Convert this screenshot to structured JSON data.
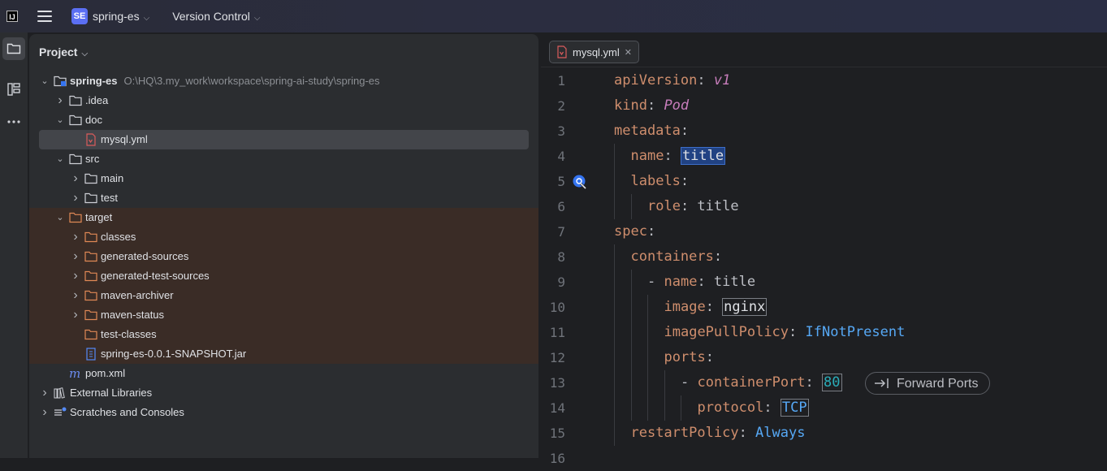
{
  "titlebar": {
    "app_logo": "IJ",
    "project_badge": "SE",
    "project_name": "spring-es",
    "vcs_label": "Version Control"
  },
  "panel": {
    "title": "Project"
  },
  "tree": [
    {
      "label": "spring-es",
      "hint": "O:\\HQ\\3.my_work\\workspace\\spring-ai-study\\spring-es",
      "icon": "module-folder-icon",
      "arrow": "down",
      "depth": 0
    },
    {
      "label": ".idea",
      "icon": "folder-icon",
      "arrow": "right",
      "depth": 1
    },
    {
      "label": "doc",
      "icon": "folder-icon",
      "arrow": "down",
      "depth": 1
    },
    {
      "label": "mysql.yml",
      "icon": "yaml-file-icon",
      "arrow": "",
      "depth": 2,
      "selected": true
    },
    {
      "label": "src",
      "icon": "folder-icon",
      "arrow": "down",
      "depth": 1
    },
    {
      "label": "main",
      "icon": "folder-icon",
      "arrow": "right",
      "depth": 2
    },
    {
      "label": "test",
      "icon": "folder-icon",
      "arrow": "right",
      "depth": 2
    },
    {
      "label": "target",
      "icon": "excluded-folder-icon",
      "arrow": "down",
      "depth": 1,
      "excluded": true
    },
    {
      "label": "classes",
      "icon": "excluded-folder-icon",
      "arrow": "right",
      "depth": 2,
      "excluded": true
    },
    {
      "label": "generated-sources",
      "icon": "excluded-folder-icon",
      "arrow": "right",
      "depth": 2,
      "excluded": true
    },
    {
      "label": "generated-test-sources",
      "icon": "excluded-folder-icon",
      "arrow": "right",
      "depth": 2,
      "excluded": true
    },
    {
      "label": "maven-archiver",
      "icon": "excluded-folder-icon",
      "arrow": "right",
      "depth": 2,
      "excluded": true
    },
    {
      "label": "maven-status",
      "icon": "excluded-folder-icon",
      "arrow": "right",
      "depth": 2,
      "excluded": true
    },
    {
      "label": "test-classes",
      "icon": "excluded-folder-icon",
      "arrow": "",
      "depth": 2,
      "excluded": true
    },
    {
      "label": "spring-es-0.0.1-SNAPSHOT.jar",
      "icon": "jar-file-icon",
      "arrow": "",
      "depth": 2,
      "excluded": true
    },
    {
      "label": "pom.xml",
      "icon": "maven-icon",
      "arrow": "",
      "depth": 1
    },
    {
      "label": "External Libraries",
      "icon": "libraries-icon",
      "arrow": "right",
      "depth": 0
    },
    {
      "label": "Scratches and Consoles",
      "icon": "scratches-icon",
      "arrow": "right",
      "depth": 0
    }
  ],
  "editor": {
    "tab_label": "mysql.yml",
    "forward_ports": "Forward Ports",
    "lines": [
      {
        "n": "1",
        "indent": 0,
        "segs": [
          [
            "key",
            "apiVersion"
          ],
          [
            "plain",
            ": "
          ],
          [
            "val-kw",
            "v1"
          ]
        ]
      },
      {
        "n": "2",
        "indent": 0,
        "segs": [
          [
            "key",
            "kind"
          ],
          [
            "plain",
            ": "
          ],
          [
            "val-kw",
            "Pod"
          ]
        ]
      },
      {
        "n": "3",
        "indent": 0,
        "segs": [
          [
            "key",
            "metadata"
          ],
          [
            "plain",
            ":"
          ]
        ]
      },
      {
        "n": "4",
        "indent": 1,
        "segs": [
          [
            "key",
            "name"
          ],
          [
            "plain",
            ": "
          ],
          [
            "hl-sel",
            "title"
          ]
        ]
      },
      {
        "n": "5",
        "indent": 1,
        "segs": [
          [
            "key",
            "labels"
          ],
          [
            "plain",
            ":"
          ]
        ]
      },
      {
        "n": "6",
        "indent": 2,
        "segs": [
          [
            "key",
            "role"
          ],
          [
            "plain",
            ": title"
          ]
        ]
      },
      {
        "n": "7",
        "indent": 0,
        "segs": [
          [
            "key",
            "spec"
          ],
          [
            "plain",
            ":"
          ]
        ]
      },
      {
        "n": "8",
        "indent": 1,
        "segs": [
          [
            "key",
            "containers"
          ],
          [
            "plain",
            ":"
          ]
        ]
      },
      {
        "n": "9",
        "indent": 2,
        "segs": [
          [
            "plain",
            "- "
          ],
          [
            "key",
            "name"
          ],
          [
            "plain",
            ": title"
          ]
        ]
      },
      {
        "n": "10",
        "indent": 3,
        "segs": [
          [
            "key",
            "image"
          ],
          [
            "plain",
            ": "
          ],
          [
            "boxed",
            "nginx"
          ]
        ]
      },
      {
        "n": "11",
        "indent": 3,
        "segs": [
          [
            "key",
            "imagePullPolicy"
          ],
          [
            "plain",
            ": "
          ],
          [
            "val-blue",
            "IfNotPresent"
          ]
        ]
      },
      {
        "n": "12",
        "indent": 3,
        "segs": [
          [
            "key",
            "ports"
          ],
          [
            "plain",
            ":"
          ]
        ]
      },
      {
        "n": "13",
        "indent": 4,
        "segs": [
          [
            "plain",
            "- "
          ],
          [
            "key",
            "containerPort"
          ],
          [
            "plain",
            ": "
          ],
          [
            "boxed-teal",
            "80"
          ]
        ]
      },
      {
        "n": "14",
        "indent": 5,
        "segs": [
          [
            "key",
            "protocol"
          ],
          [
            "plain",
            ": "
          ],
          [
            "boxed-blue",
            "TCP"
          ]
        ]
      },
      {
        "n": "15",
        "indent": 1,
        "segs": [
          [
            "key",
            "restartPolicy"
          ],
          [
            "plain",
            ": "
          ],
          [
            "val-blue",
            "Always"
          ]
        ]
      },
      {
        "n": "16",
        "indent": 0,
        "segs": []
      }
    ]
  },
  "colors": {
    "background": "#1e1f22",
    "panel": "#2b2d30",
    "selection": "#43454a",
    "excluded_row": "#3a2c26",
    "yaml_key": "#cf8e6d",
    "yaml_value_keyword": "#c77dbb",
    "yaml_value_blue": "#56a8f5",
    "yaml_number": "#2aacb8"
  }
}
